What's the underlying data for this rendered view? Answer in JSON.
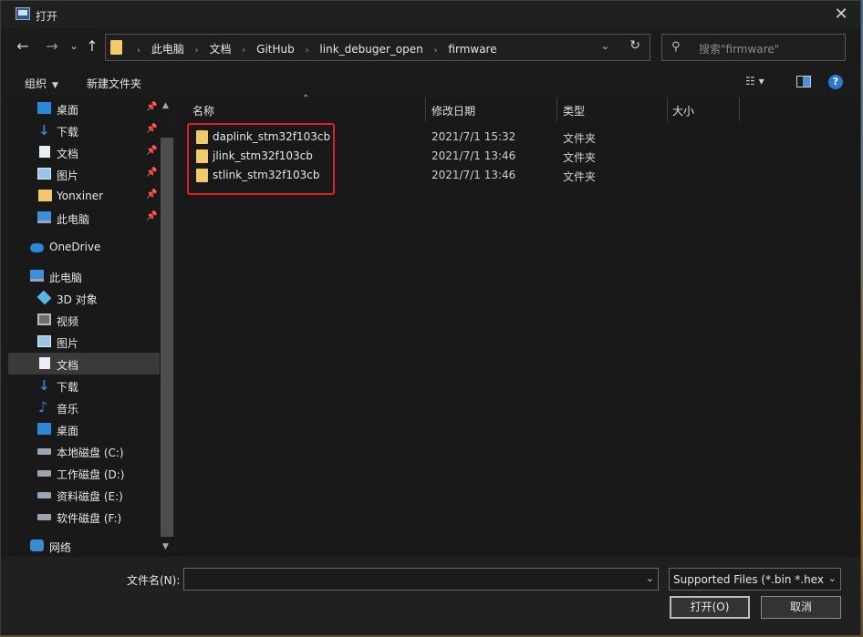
{
  "window": {
    "title": "打开"
  },
  "address": {
    "crumbs": [
      "此电脑",
      "文档",
      "GitHub",
      "link_debuger_open",
      "firmware"
    ]
  },
  "search": {
    "placeholder": "搜索\"firmware\""
  },
  "toolbar": {
    "organize_label": "组织",
    "new_folder_label": "新建文件夹"
  },
  "sidebar": {
    "items": [
      {
        "label": "桌面",
        "icon": "desktop-icon",
        "pinned": true
      },
      {
        "label": "下载",
        "icon": "download-icon",
        "pinned": true
      },
      {
        "label": "文档",
        "icon": "document-icon",
        "pinned": true
      },
      {
        "label": "图片",
        "icon": "pictures-icon",
        "pinned": true
      },
      {
        "label": "Yonxiner",
        "icon": "folder-icon",
        "pinned": true
      },
      {
        "label": "此电脑",
        "icon": "this-pc-icon",
        "pinned": true
      },
      {
        "label": "OneDrive",
        "icon": "onedrive-icon"
      },
      {
        "label": "此电脑",
        "icon": "this-pc-icon"
      },
      {
        "label": "3D 对象",
        "icon": "3d-objects-icon"
      },
      {
        "label": "视频",
        "icon": "videos-icon"
      },
      {
        "label": "图片",
        "icon": "pictures-icon"
      },
      {
        "label": "文档",
        "icon": "document-icon",
        "selected": true
      },
      {
        "label": "下载",
        "icon": "download-icon"
      },
      {
        "label": "音乐",
        "icon": "music-icon"
      },
      {
        "label": "桌面",
        "icon": "desktop-icon"
      },
      {
        "label": "本地磁盘 (C:)",
        "icon": "drive-icon"
      },
      {
        "label": "工作磁盘 (D:)",
        "icon": "drive-icon"
      },
      {
        "label": "资料磁盘 (E:)",
        "icon": "drive-icon"
      },
      {
        "label": "软件磁盘 (F:)",
        "icon": "drive-icon"
      },
      {
        "label": "网络",
        "icon": "network-icon"
      }
    ]
  },
  "filelist": {
    "columns": {
      "name": "名称",
      "date": "修改日期",
      "type": "类型",
      "size": "大小"
    },
    "rows": [
      {
        "name": "daplink_stm32f103cb",
        "date": "2021/7/1 15:32",
        "type": "文件夹"
      },
      {
        "name": "jlink_stm32f103cb",
        "date": "2021/7/1 13:46",
        "type": "文件夹"
      },
      {
        "name": "stlink_stm32f103cb",
        "date": "2021/7/1 13:46",
        "type": "文件夹"
      }
    ],
    "highlight_color": "#e02020"
  },
  "footer": {
    "filename_label": "文件名(N):",
    "filename_value": "",
    "filter_value": "Supported Files (*.bin *.hex *",
    "open_label": "打开(O)",
    "cancel_label": "取消"
  }
}
